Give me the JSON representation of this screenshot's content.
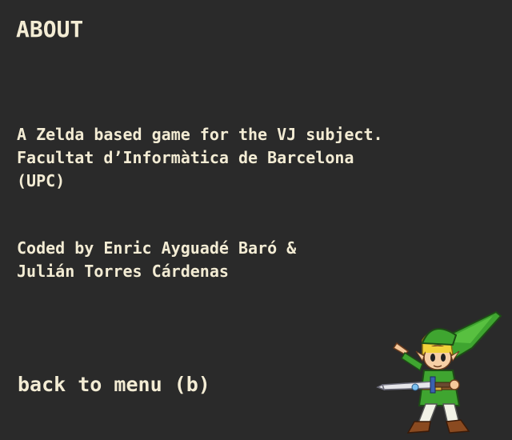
{
  "screen": {
    "title": "ABOUT",
    "description_lines": [
      "A Zelda based game for the VJ subject.",
      "Facultat d’Informàtica de Barcelona",
      "(UPC)"
    ],
    "credit_lines": [
      "Coded by Enric Ayguadé Baró &",
      "Julián Torres Cárdenas"
    ],
    "back_label": "back to menu (b)"
  },
  "colors": {
    "background": "#2a2a2a",
    "text": "#f3ecd4"
  },
  "icons": {
    "character": "link-swordsman-sprite"
  }
}
